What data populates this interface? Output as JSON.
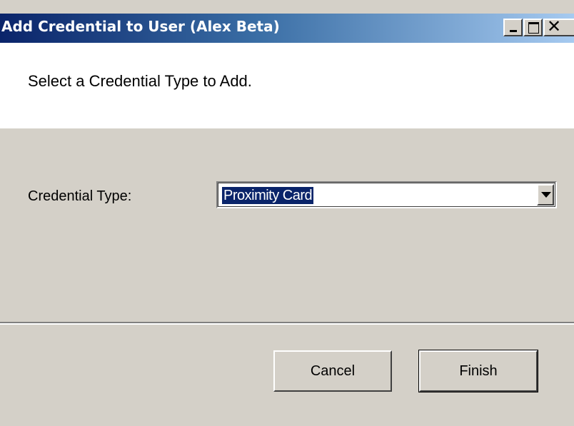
{
  "window": {
    "title": "Add Credential to User (Alex Beta)",
    "controls": {
      "minimize_icon": "minimize-icon",
      "maximize_icon": "maximize-icon",
      "close_icon": "close-icon"
    }
  },
  "header": {
    "instruction": "Select a Credential Type to Add."
  },
  "form": {
    "credential_type_label": "Credential Type:",
    "credential_type_value": "Proximity Card"
  },
  "buttons": {
    "cancel_label": "Cancel",
    "finish_label": "Finish"
  },
  "colors": {
    "title_bar_start": "#0a246a",
    "title_bar_end": "#a6caf0",
    "selection": "#0a246a",
    "dialog_face": "#d4d0c8"
  }
}
